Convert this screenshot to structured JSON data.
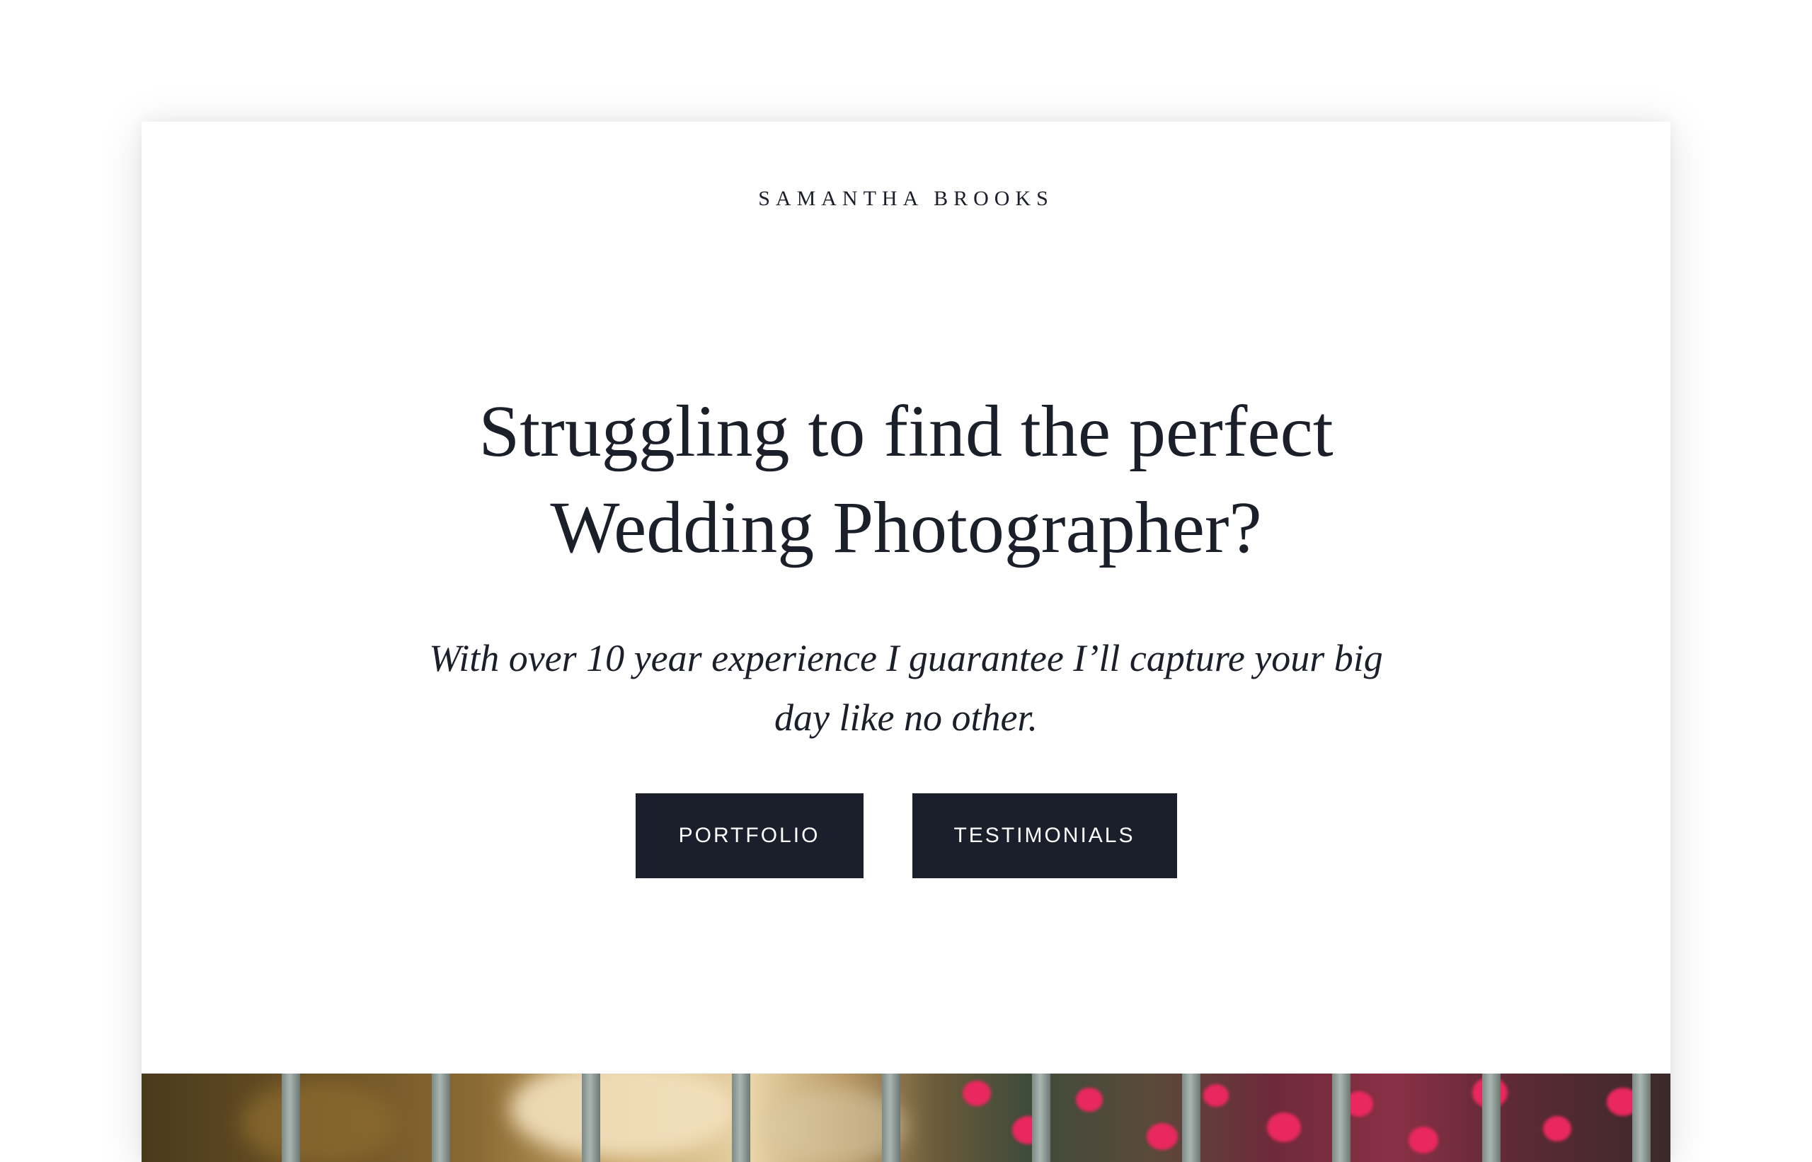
{
  "brand": {
    "name": "SAMANTHA BROOKS"
  },
  "hero": {
    "headline_line1": "Struggling to find the perfect",
    "headline_line2": "Wedding Photographer?",
    "subline_line1": "With over 10 year experience I guarantee I’ll capture your big",
    "subline_line2": "day like no other."
  },
  "buttons": {
    "portfolio_label": "PORTFOLIO",
    "testimonials_label": "TESTIMONIALS"
  },
  "colors": {
    "primary_dark": "#1b1f2c",
    "text": "#1b1f2a",
    "background": "#ffffff",
    "flower_accent": "#e8285e"
  },
  "images": {
    "hero_photo": "photo-of-fence-and-pink-flowers"
  }
}
